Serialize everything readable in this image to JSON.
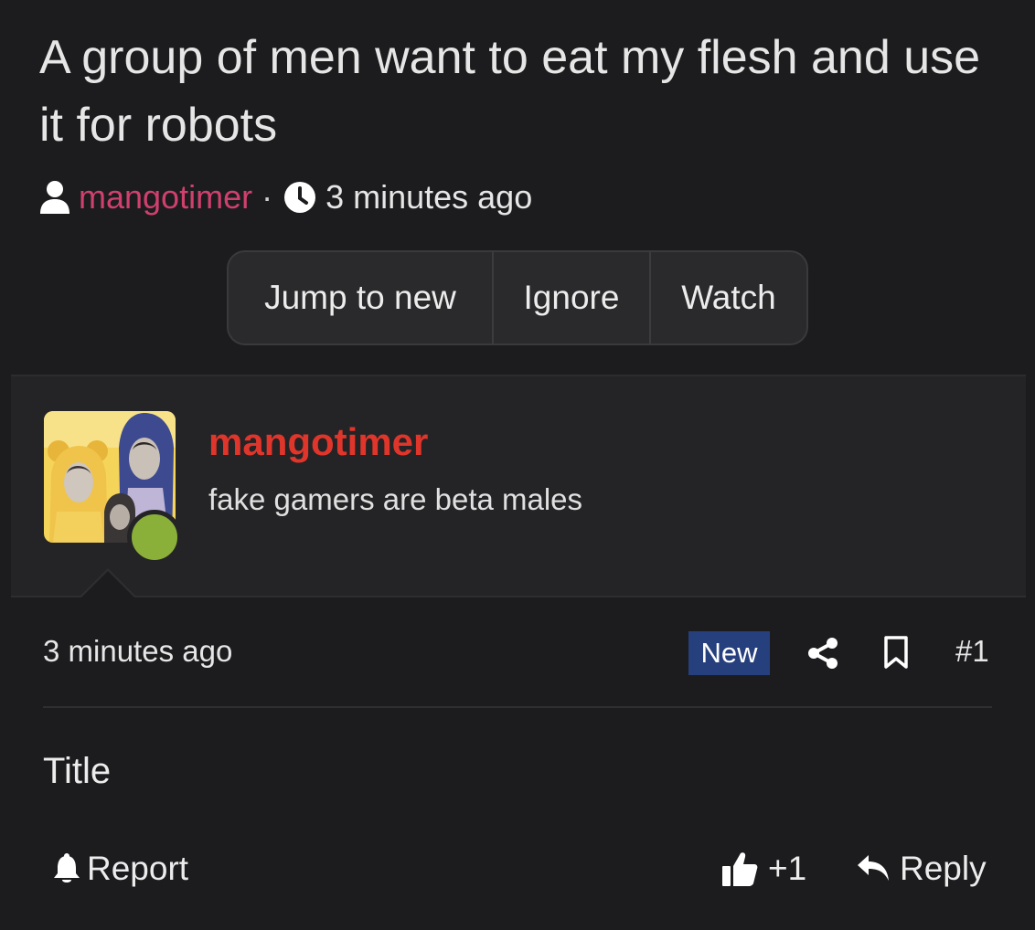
{
  "thread": {
    "title": "A group of men want to eat my flesh and use it for robots",
    "author": "mangotimer",
    "separator": "·",
    "time": "3 minutes ago"
  },
  "actions": {
    "jump_to_new": "Jump to new",
    "ignore": "Ignore",
    "watch": "Watch"
  },
  "post": {
    "username": "mangotimer",
    "user_title": "fake gamers are beta males",
    "time": "3 minutes ago",
    "badge": "New",
    "number": "#1",
    "body": "Title",
    "report_label": "Report",
    "like_count": "+1",
    "reply_label": "Reply"
  },
  "colors": {
    "background": "#1c1c1e",
    "author_link": "#d0406e",
    "post_username": "#e0352b",
    "new_badge": "#263f7d",
    "online_status": "#8ab03a"
  },
  "icons": [
    "user-icon",
    "clock-icon",
    "share-icon",
    "bookmark-icon",
    "bell-icon",
    "thumbs-up-icon",
    "reply-icon"
  ]
}
